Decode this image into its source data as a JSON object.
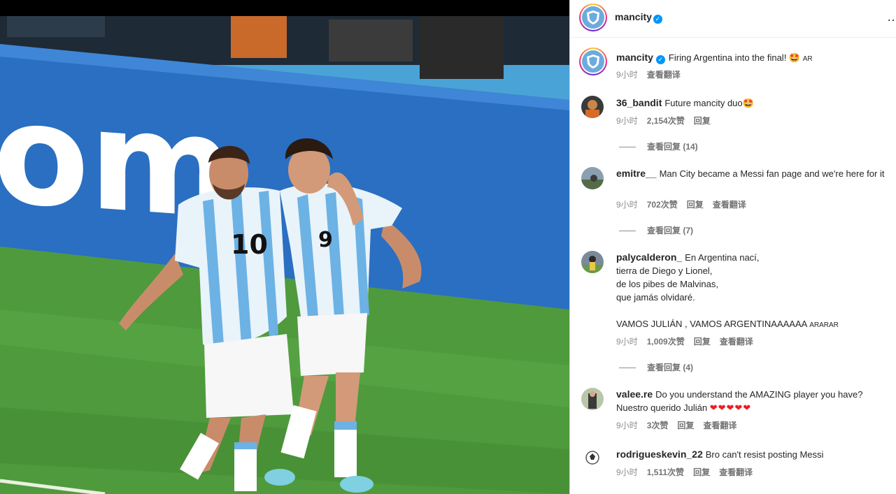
{
  "post": {
    "author": "mancity",
    "verified_icon": "verified-badge-icon",
    "more_icon": "more-options-icon"
  },
  "caption": {
    "username": "mancity",
    "text": "Firing Argentina into the final! 🤩",
    "tag": "AR",
    "time": "9小时",
    "translate": "查看翻译"
  },
  "comments": [
    {
      "username": "36_bandit",
      "text": "Future mancity duo🤩",
      "time": "9小时",
      "likes": "2,154次赞",
      "reply": "回复",
      "translate": "",
      "view_replies": "查看回复 (14)"
    },
    {
      "username": "emitre__",
      "text": "Man City became a Messi fan page and we're here for it",
      "time": "9小时",
      "likes": "702次赞",
      "reply": "回复",
      "translate": "查看翻译",
      "view_replies": "查看回复 (7)"
    },
    {
      "username": "palycalderon_",
      "text_lines": [
        "En Argentina nací,",
        "tierra de Diego y Lionel,",
        "de los pibes de Malvinas,",
        "que jamás olvidaré.",
        "",
        "VAMOS JULIÁN , VAMOS ARGENTINAAAAAA"
      ],
      "tag": "ARARAR",
      "time": "9小时",
      "likes": "1,009次赞",
      "reply": "回复",
      "translate": "查看翻译",
      "view_replies": "查看回复 (4)"
    },
    {
      "username": "valee.re",
      "text": "Do you understand the AMAZING player you have? Nuestro querido Julián",
      "hearts": "❤❤❤❤❤",
      "time": "9小时",
      "likes": "3次赞",
      "reply": "回复",
      "translate": "查看翻译",
      "view_replies": ""
    },
    {
      "username": "rodrigueskevin_22",
      "text": "Bro can't resist posting Messi",
      "time": "9小时",
      "likes": "1,511次赞",
      "reply": "回复",
      "translate": "查看翻译",
      "view_replies": ""
    }
  ],
  "photo": {
    "jersey_left": "10",
    "jersey_right": "9",
    "board_text": "om"
  },
  "colors": {
    "link_blue": "#0095f6",
    "meta_gray": "#8e8e8e",
    "heart_red": "#ed1c24",
    "city_blue": "#6cabdd"
  }
}
